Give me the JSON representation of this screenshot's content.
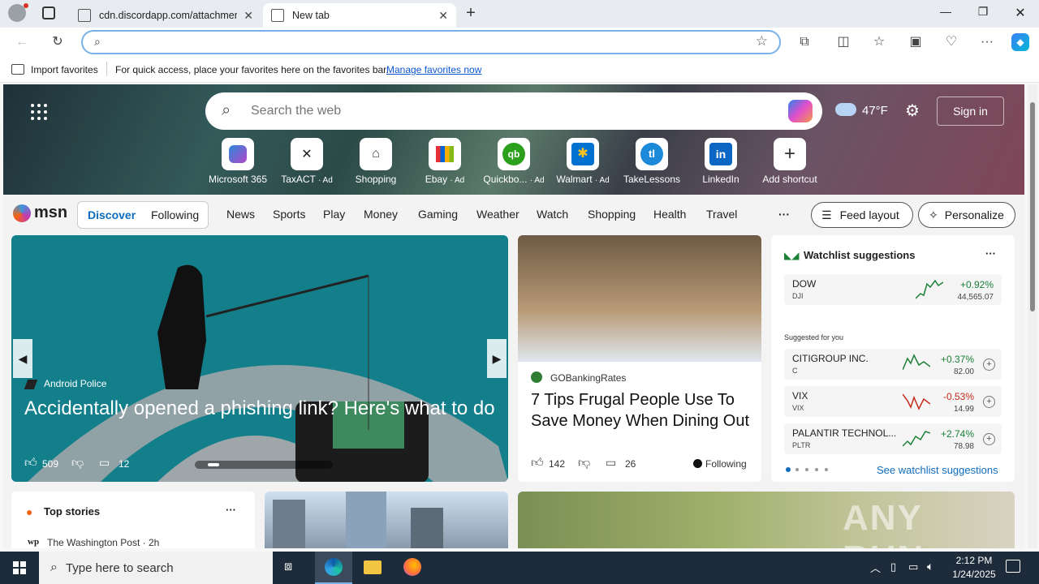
{
  "tabs": [
    {
      "label": "cdn.discordapp.com/attachment"
    },
    {
      "label": "New tab"
    }
  ],
  "address": {
    "value": "",
    "placeholder": ""
  },
  "favorites_bar": {
    "import_label": "Import favorites",
    "message": "For quick access, place your favorites here on the favorites bar.",
    "manage_link": "Manage favorites now"
  },
  "hero": {
    "search_placeholder": "Search the web",
    "temperature": "47°F",
    "sign_in": "Sign in",
    "shortcuts": [
      {
        "label": "Microsoft 365",
        "ad": ""
      },
      {
        "label": "TaxACT",
        "ad": "· Ad"
      },
      {
        "label": "Shopping",
        "ad": ""
      },
      {
        "label": "Ebay",
        "ad": "· Ad"
      },
      {
        "label": "Quickbo...",
        "ad": "· Ad"
      },
      {
        "label": "Walmart",
        "ad": "· Ad"
      },
      {
        "label": "TakeLessons",
        "ad": ""
      },
      {
        "label": "LinkedIn",
        "ad": ""
      },
      {
        "label": "Add shortcut",
        "ad": ""
      }
    ]
  },
  "msn": {
    "logo": "msn",
    "discover": "Discover",
    "following": "Following",
    "nav": [
      "News",
      "Sports",
      "Play",
      "Money",
      "Gaming",
      "Weather",
      "Watch",
      "Shopping",
      "Health",
      "Travel"
    ],
    "more": "···",
    "feed_layout": "Feed layout",
    "personalize": "Personalize"
  },
  "main_story": {
    "source": "Android Police",
    "headline": "Accidentally opened a phishing link? Here's what to do",
    "likes": "509",
    "comments": "12"
  },
  "story2": {
    "source": "GOBankingRates",
    "headline": "7 Tips Frugal People Use To Save Money When Dining Out",
    "likes": "142",
    "comments": "26",
    "following": "Following"
  },
  "watchlist": {
    "title": "Watchlist suggestions",
    "more": "···",
    "suggested_label": "Suggested for you",
    "see_more": "See watchlist suggestions",
    "items": [
      {
        "name": "DOW",
        "symbol": "DJI",
        "pct": "+0.92%",
        "value": "44,565.07",
        "color": "#1a7f37"
      },
      {
        "name": "CITIGROUP INC.",
        "symbol": "C",
        "pct": "+0.37%",
        "value": "82.00",
        "color": "#1a7f37"
      },
      {
        "name": "VIX",
        "symbol": "VIX",
        "pct": "-0.53%",
        "value": "14.99",
        "color": "#c42b1c"
      },
      {
        "name": "PALANTIR TECHNOL...",
        "symbol": "PLTR",
        "pct": "+2.74%",
        "value": "78.98",
        "color": "#1a7f37"
      }
    ]
  },
  "top_stories": {
    "title": "Top stories",
    "more": "···",
    "first_source": "The Washington Post · 2h"
  },
  "taskbar": {
    "search_placeholder": "Type here to search",
    "time": "2:12 PM",
    "date": "1/24/2025"
  },
  "watermark": "ANY RUN"
}
